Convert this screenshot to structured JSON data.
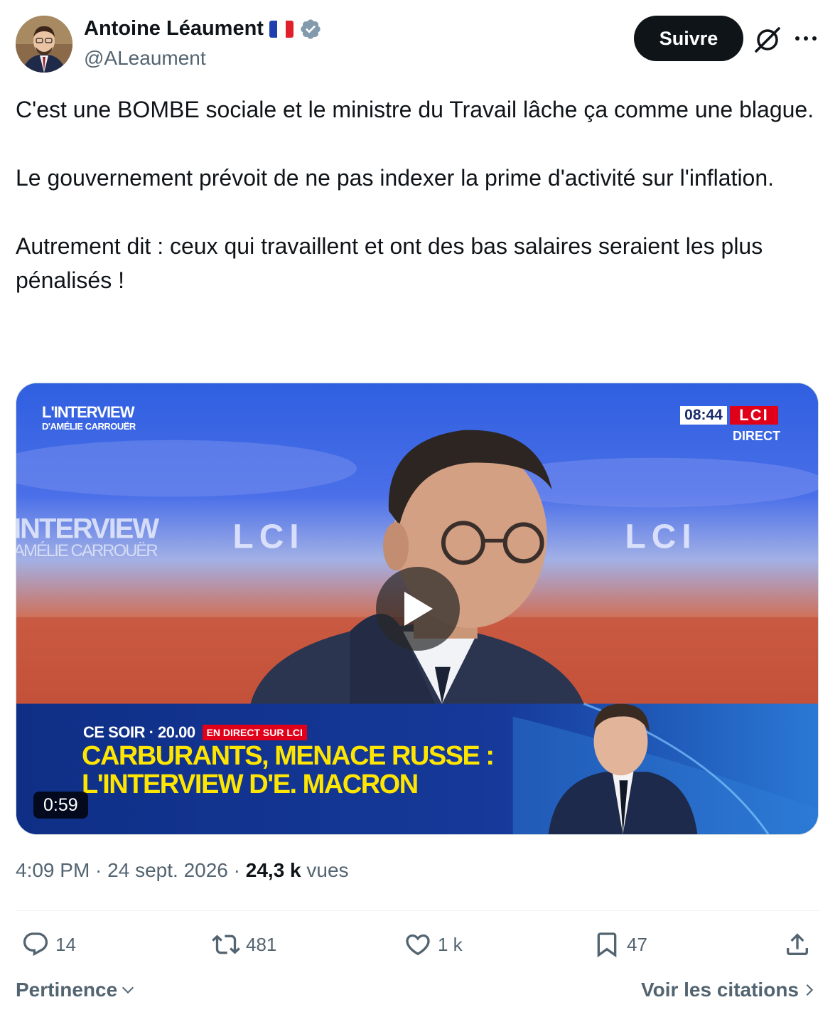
{
  "author": {
    "name": "Antoine Léaument",
    "handle": "@ALeaument",
    "flag_icon": "france-flag-icon",
    "verified_icon": "verified-badge-icon"
  },
  "header": {
    "follow_label": "Suivre"
  },
  "tweet": {
    "paragraphs": [
      "C'est une BOMBE sociale et le ministre du Travail lâche ça comme une blague.",
      "Le gouvernement prévoit de ne pas indexer la prime d'activité sur l'inflation.",
      "Autrement dit : ceux qui travaillent et ont des bas salaires seraient les plus pénalisés !"
    ]
  },
  "video": {
    "duration": "0:59",
    "overlay": {
      "logo_line1": "L'INTERVIEW",
      "logo_line2": "D'AMÉLIE CARROUËR",
      "clock": "08:44",
      "channel": "LCI",
      "live": "DIRECT",
      "banner_time": "CE SOIR · 20.00",
      "banner_tag": "EN DIRECT SUR LCI",
      "headline_1": "CARBURANTS, MENACE RUSSE :",
      "headline_2": "L'INTERVIEW D'E. MACRON",
      "backdrop_word": "INTERVIEW",
      "backdrop_sub": "AMÉLIE CARROUËR"
    }
  },
  "meta": {
    "time": "4:09 PM",
    "separator": " · ",
    "date": "24 sept. 2026",
    "views_count": "24,3 k",
    "views_label": "vues"
  },
  "actions": {
    "replies": "14",
    "reposts": "481",
    "likes": "1 k",
    "bookmarks": "47"
  },
  "footer": {
    "sort_label": "Pertinence",
    "quotes_label": "Voir les citations"
  },
  "colors": {
    "text": "#0f1419",
    "muted": "#536471",
    "verified": "#829aab",
    "follow_bg": "#0f1419"
  }
}
